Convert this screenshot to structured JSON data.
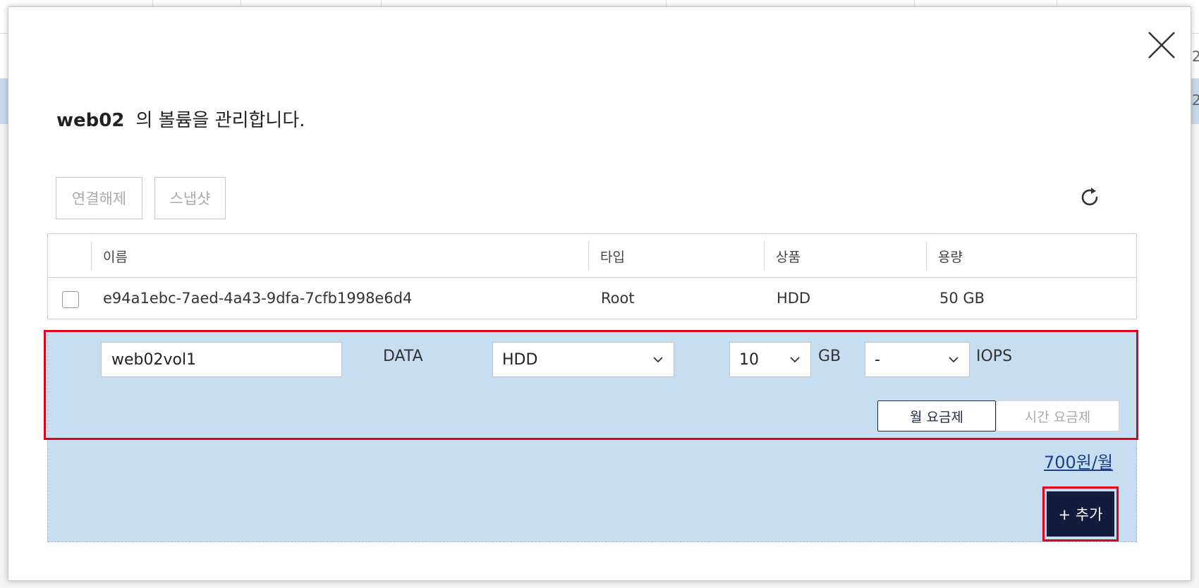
{
  "background": {
    "edge_digits": [
      "2",
      "2"
    ]
  },
  "modal": {
    "server_name": "web02",
    "title_suffix": "의 볼륨을 관리합니다."
  },
  "toolbar": {
    "detach_label": "연결해제",
    "snapshot_label": "스냅샷"
  },
  "table": {
    "headers": [
      "이름",
      "타입",
      "상품",
      "용량"
    ],
    "rows": [
      {
        "name": "e94a1ebc-7aed-4a43-9dfa-7cfb1998e6d4",
        "type": "Root",
        "product": "HDD",
        "capacity": "50 GB"
      }
    ]
  },
  "add_form": {
    "name_value": "web02vol1",
    "type": "DATA",
    "product_selected": "HDD",
    "size_selected": "10",
    "size_unit": "GB",
    "iops_selected": "-",
    "iops_unit": "IOPS",
    "billing_monthly": "월 요금제",
    "billing_hourly": "시간 요금제",
    "price": "700원/월",
    "add_label": "+ 추가"
  },
  "colors": {
    "highlight": "#e3001b",
    "add_area_bg": "#c7ddf2",
    "primary_button": "#141c3d",
    "price_link": "#1c3f88"
  }
}
